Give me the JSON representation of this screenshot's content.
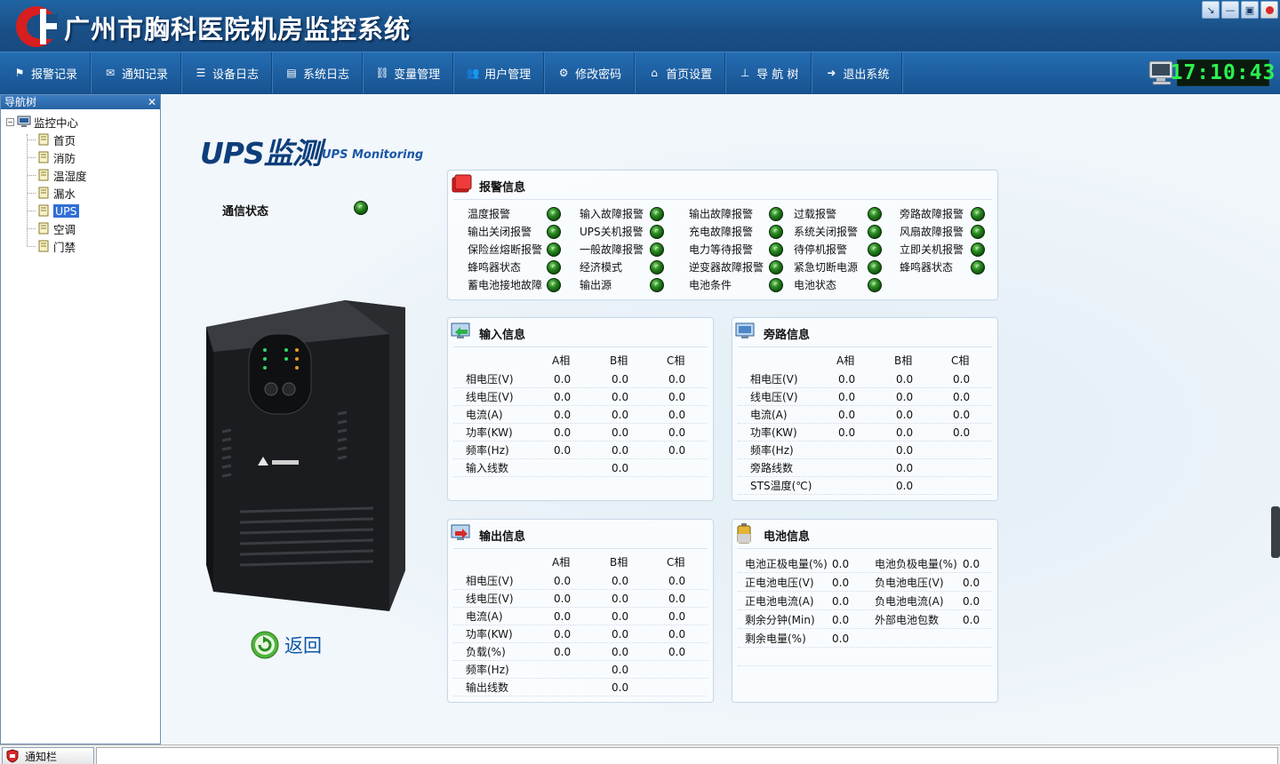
{
  "window": {
    "title": "广州市胸科医院机房监控系统",
    "controls": [
      "restore-down",
      "minimize",
      "maximize",
      "close"
    ]
  },
  "menu": {
    "items": [
      {
        "label": "报警记录",
        "icon": "flag-icon"
      },
      {
        "label": "通知记录",
        "icon": "mail-icon"
      },
      {
        "label": "设备日志",
        "icon": "list-icon"
      },
      {
        "label": "系统日志",
        "icon": "log-icon"
      },
      {
        "label": "变量管理",
        "icon": "link-icon"
      },
      {
        "label": "用户管理",
        "icon": "users-icon"
      },
      {
        "label": "修改密码",
        "icon": "gear-icon"
      },
      {
        "label": "首页设置",
        "icon": "home-icon"
      },
      {
        "label": "导 航 树",
        "icon": "tree-icon"
      },
      {
        "label": "退出系统",
        "icon": "exit-arrow-icon"
      }
    ],
    "clock": "17:10:43"
  },
  "nav": {
    "header": "导航树",
    "root": "监控中心",
    "items": [
      "首页",
      "消防",
      "温湿度",
      "漏水",
      "UPS",
      "空调",
      "门禁"
    ],
    "selected": "UPS"
  },
  "page": {
    "title": "UPS监测",
    "subtitle": "UPS Monitoring",
    "comm_label": "通信状态",
    "back_label": "返回"
  },
  "alarm": {
    "title": "报警信息",
    "columns": [
      [
        "温度报警",
        "输出关闭报警",
        "保险丝熔断报警",
        "蜂鸣器状态",
        "蓄电池接地故障"
      ],
      [
        "输入故障报警",
        "UPS关机报警",
        "一般故障报警",
        "经济模式",
        "输出源"
      ],
      [
        "输出故障报警",
        "充电故障报警",
        "电力等待报警",
        "逆变器故障报警",
        "电池条件"
      ],
      [
        "过载报警",
        "系统关闭报警",
        "待停机报警",
        "紧急切断电源",
        "电池状态"
      ],
      [
        "旁路故障报警",
        "风扇故障报警",
        "立即关机报警",
        "蜂鸣器状态"
      ]
    ]
  },
  "input": {
    "title": "输入信息",
    "headers": [
      "A相",
      "B相",
      "C相"
    ],
    "rows": [
      {
        "label": "相电压(V)",
        "a": "0.0",
        "b": "0.0",
        "c": "0.0"
      },
      {
        "label": "线电压(V)",
        "a": "0.0",
        "b": "0.0",
        "c": "0.0"
      },
      {
        "label": "电流(A)",
        "a": "0.0",
        "b": "0.0",
        "c": "0.0"
      },
      {
        "label": "功率(KW)",
        "a": "0.0",
        "b": "0.0",
        "c": "0.0"
      },
      {
        "label": "频率(Hz)",
        "a": "0.0",
        "b": "0.0",
        "c": "0.0"
      },
      {
        "label": "输入线数",
        "a": "",
        "b": "0.0",
        "c": ""
      }
    ]
  },
  "bypass": {
    "title": "旁路信息",
    "headers": [
      "A相",
      "B相",
      "C相"
    ],
    "rows": [
      {
        "label": "相电压(V)",
        "a": "0.0",
        "b": "0.0",
        "c": "0.0"
      },
      {
        "label": "线电压(V)",
        "a": "0.0",
        "b": "0.0",
        "c": "0.0"
      },
      {
        "label": "电流(A)",
        "a": "0.0",
        "b": "0.0",
        "c": "0.0"
      },
      {
        "label": "功率(KW)",
        "a": "0.0",
        "b": "0.0",
        "c": "0.0"
      },
      {
        "label": "频率(Hz)",
        "a": "",
        "b": "0.0",
        "c": ""
      },
      {
        "label": "旁路线数",
        "a": "",
        "b": "0.0",
        "c": ""
      },
      {
        "label": "STS温度(℃)",
        "a": "",
        "b": "0.0",
        "c": ""
      }
    ]
  },
  "output": {
    "title": "输出信息",
    "headers": [
      "A相",
      "B相",
      "C相"
    ],
    "rows": [
      {
        "label": "相电压(V)",
        "a": "0.0",
        "b": "0.0",
        "c": "0.0"
      },
      {
        "label": "线电压(V)",
        "a": "0.0",
        "b": "0.0",
        "c": "0.0"
      },
      {
        "label": "电流(A)",
        "a": "0.0",
        "b": "0.0",
        "c": "0.0"
      },
      {
        "label": "功率(KW)",
        "a": "0.0",
        "b": "0.0",
        "c": "0.0"
      },
      {
        "label": "负载(%)",
        "a": "0.0",
        "b": "0.0",
        "c": "0.0"
      },
      {
        "label": "频率(Hz)",
        "a": "",
        "b": "0.0",
        "c": ""
      },
      {
        "label": "输出线数",
        "a": "",
        "b": "0.0",
        "c": ""
      }
    ]
  },
  "battery": {
    "title": "电池信息",
    "left": [
      {
        "label": "电池正极电量(%)",
        "value": "0.0"
      },
      {
        "label": "正电池电压(V)",
        "value": "0.0"
      },
      {
        "label": "正电池电流(A)",
        "value": "0.0"
      },
      {
        "label": "剩余分钟(Min)",
        "value": "0.0"
      },
      {
        "label": "剩余电量(%)",
        "value": "0.0"
      }
    ],
    "right": [
      {
        "label": "电池负极电量(%)",
        "value": "0.0"
      },
      {
        "label": "负电池电压(V)",
        "value": "0.0"
      },
      {
        "label": "负电池电流(A)",
        "value": "0.0"
      },
      {
        "label": "外部电池包数",
        "value": "0.0"
      }
    ]
  },
  "statusbar": {
    "notice_label": "通知栏"
  },
  "colors": {
    "titlebar": "#1a4f86",
    "menubar": "#1e5f9f",
    "clock_text": "#2df04f",
    "led_ok": "#2a8c22",
    "selected": "#2f6fd6"
  }
}
